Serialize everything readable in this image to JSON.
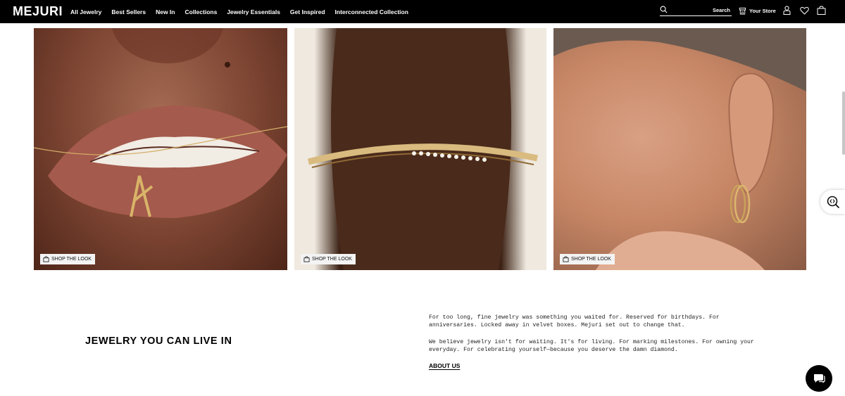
{
  "brand": {
    "logo": "MEJURI"
  },
  "nav": {
    "links": [
      "All Jewelry",
      "Best Sellers",
      "New In",
      "Collections",
      "Jewelry Essentials",
      "Get Inspired",
      "Interconnected Collection"
    ],
    "search_label": "Search",
    "store_label": "Your Store"
  },
  "gallery": {
    "shop_label": "SHOP THE LOOK"
  },
  "about": {
    "headline": "JEWELRY YOU CAN LIVE IN",
    "paragraph_1": "For too long, fine jewelry was something you waited for. Reserved for birthdays. For anniversaries. Locked away in velvet boxes. Mejuri set out to change that.",
    "paragraph_2": "We believe jewelry isn't for waiting. It's for living. For marking milestones. For owning your everyday. For celebrating yourself—because you deserve the damn diamond.",
    "link": "ABOUT US"
  },
  "colors": {
    "nav_bg": "#000000",
    "accent": "#000000"
  }
}
